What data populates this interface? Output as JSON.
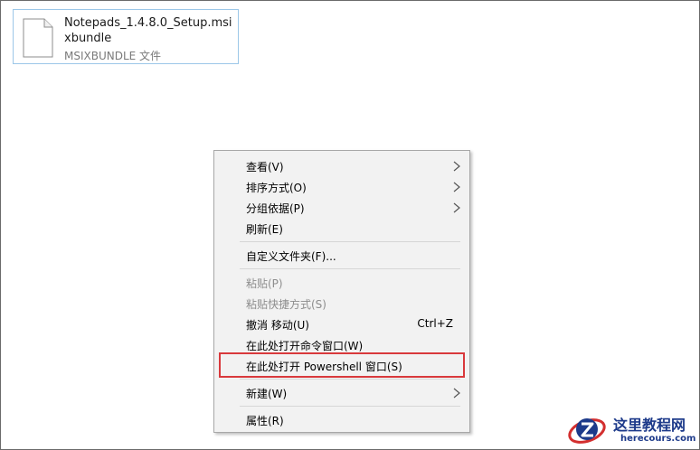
{
  "file": {
    "name": "Notepads_1.4.8.0_Setup.msixbundle",
    "type": "MSIXBUNDLE 文件"
  },
  "context_menu": {
    "items": [
      {
        "label": "查看(V)",
        "submenu": true,
        "disabled": false
      },
      {
        "label": "排序方式(O)",
        "submenu": true,
        "disabled": false
      },
      {
        "label": "分组依据(P)",
        "submenu": true,
        "disabled": false
      },
      {
        "label": "刷新(E)",
        "submenu": false,
        "disabled": false
      },
      {
        "label": "自定义文件夹(F)...",
        "submenu": false,
        "disabled": false
      },
      {
        "label": "粘贴(P)",
        "submenu": false,
        "disabled": true
      },
      {
        "label": "粘贴快捷方式(S)",
        "submenu": false,
        "disabled": true
      },
      {
        "label": "撤消 移动(U)",
        "shortcut": "Ctrl+Z",
        "submenu": false,
        "disabled": false
      },
      {
        "label": "在此处打开命令窗口(W)",
        "submenu": false,
        "disabled": false
      },
      {
        "label": "在此处打开 Powershell 窗口(S)",
        "submenu": false,
        "disabled": false,
        "highlighted": true
      },
      {
        "label": "新建(W)",
        "submenu": true,
        "disabled": false
      },
      {
        "label": "属性(R)",
        "submenu": false,
        "disabled": false
      }
    ]
  },
  "watermark": {
    "title": "这里教程网",
    "url": "herecours.com"
  },
  "colors": {
    "highlight_border": "#d9393c",
    "menu_background": "#f2f2f2",
    "file_tile_border": "#9cc7e8"
  }
}
